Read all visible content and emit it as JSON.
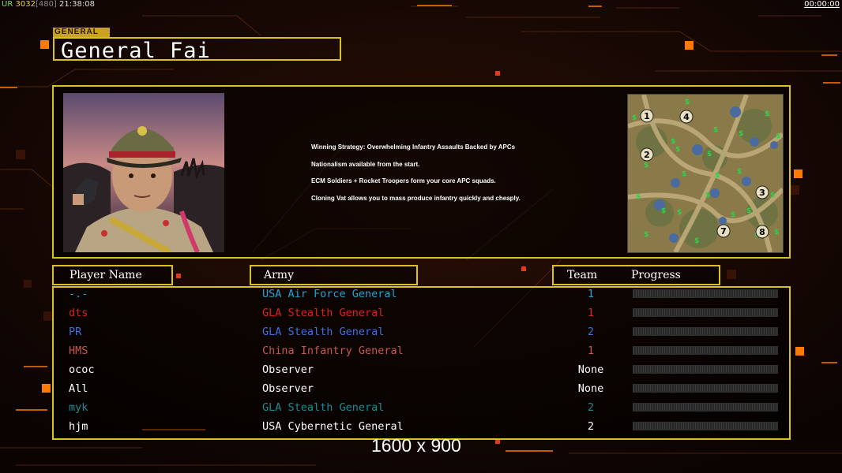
{
  "hud": {
    "ur_label": "UR",
    "fps_a": "30",
    "fps_b": "32",
    "fps_c": "[480]",
    "time": "21:38:08",
    "timer": "00:00:00"
  },
  "general": {
    "tag": "GENERAL",
    "name": "General Fai"
  },
  "strategy": [
    "Winning Strategy: Overwhelming Infantry Assaults Backed by APCs",
    "Nationalism available from the start.",
    "ECM Soldiers + Rocket Troopers form your core APC squads.",
    "Cloning Vat allows you to mass produce infantry quickly and cheaply."
  ],
  "minimap": {
    "start_positions": [
      "1",
      "4",
      "2",
      "3",
      "7",
      "8"
    ]
  },
  "headers": {
    "player_name": "Player Name",
    "army": "Army",
    "team": "Team",
    "progress": "Progress"
  },
  "players": [
    {
      "name": "-.-",
      "army": "USA Air Force General",
      "team": "1",
      "color": "#1fa4d4"
    },
    {
      "name": "dts",
      "army": "GLA Stealth General",
      "team": "1",
      "color": "#d9221c"
    },
    {
      "name": "PR",
      "army": "GLA Stealth General",
      "team": "2",
      "color": "#3f6fe0"
    },
    {
      "name": "HMS",
      "army": "China Infantry General",
      "team": "1",
      "color": "#c8584e"
    },
    {
      "name": "ococ",
      "army": "Observer",
      "team": "None",
      "color": "#ffffff"
    },
    {
      "name": "All",
      "army": "Observer",
      "team": "None",
      "color": "#ffffff"
    },
    {
      "name": "myk",
      "army": "GLA Stealth General",
      "team": "2",
      "color": "#1d8a96"
    },
    {
      "name": "hjm",
      "army": "USA Cybernetic General",
      "team": "2",
      "color": "#ffffff"
    }
  ],
  "resolution": "1600 x 900",
  "colors": {
    "frame": "#d8c21b",
    "accent_orange": "#ff7a00",
    "background": "#0d0503"
  }
}
